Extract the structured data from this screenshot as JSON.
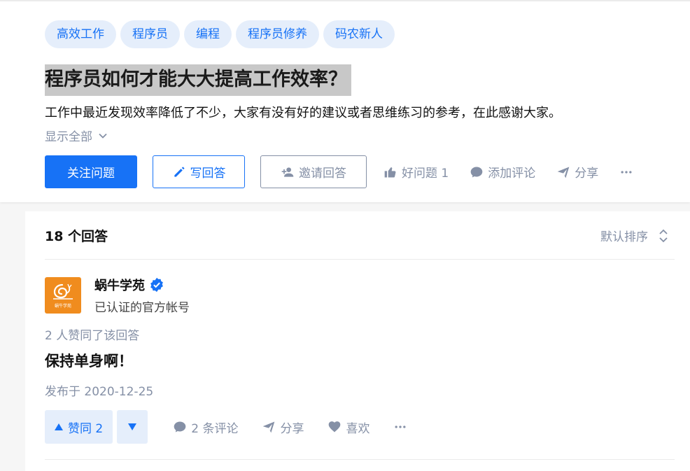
{
  "question": {
    "tags": [
      "高效工作",
      "程序员",
      "编程",
      "程序员修养",
      "码农新人"
    ],
    "title": "程序员如何才能大大提高工作效率？",
    "detail": "工作中最近发现效率降低了不少，大家有没有好的建议或者思维练习的参考，在此感谢大家。",
    "show_all": "显示全部",
    "actions": {
      "follow": "关注问题",
      "write": "写回答",
      "invite": "邀请回答",
      "good_question": "好问题 1",
      "add_comment": "添加评论",
      "share": "分享"
    }
  },
  "answers": {
    "count_label": "18 个回答",
    "sort_label": "默认排序",
    "items": [
      {
        "author": {
          "name": "蜗牛学苑",
          "bio": "已认证的官方帐号",
          "avatar_caption": "蜗牛学苑"
        },
        "voters": "2 人赞同了该回答",
        "content": "保持单身啊！",
        "published": "发布于 2020-12-25",
        "actions": {
          "vote_up": "赞同 2",
          "comments": "2 条评论",
          "share": "分享",
          "like": "喜欢"
        }
      }
    ]
  },
  "colors": {
    "brand_blue": "#1772f6",
    "tag_bg": "#e5eefb",
    "muted_gray": "#8590a6",
    "avatar_orange": "#f08c1e"
  }
}
